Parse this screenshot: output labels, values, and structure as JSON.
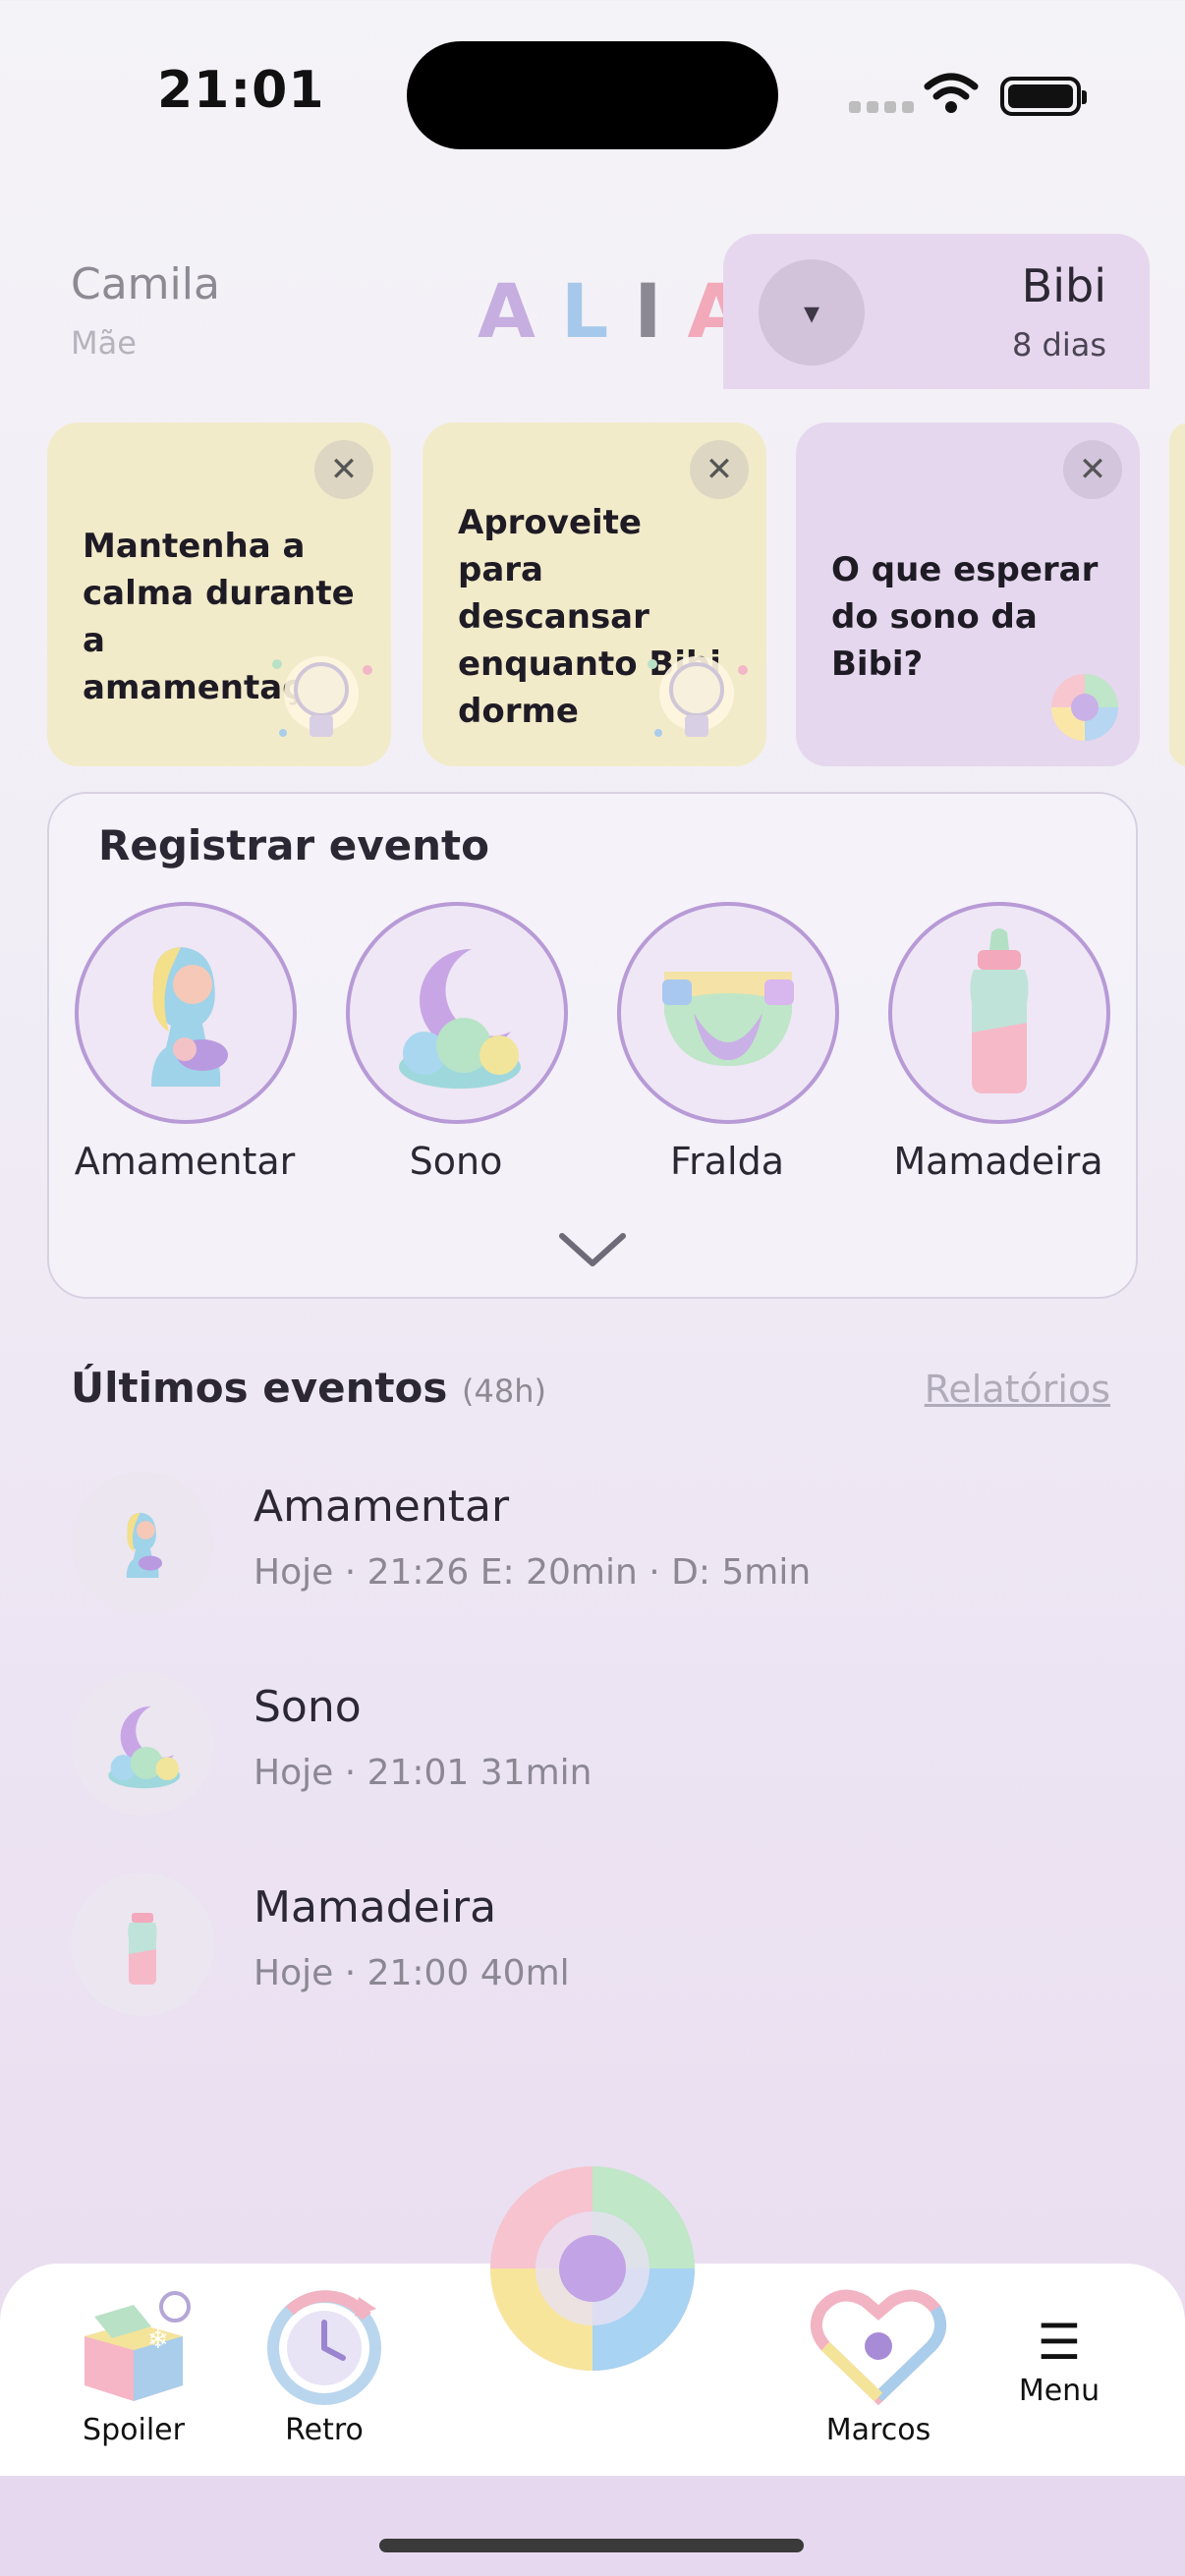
{
  "status_bar": {
    "time": "21:01"
  },
  "header": {
    "user_name": "Camila",
    "user_role": "Mãe",
    "logo": {
      "a1": "A",
      "l": "L",
      "i": "I",
      "a2": "A"
    },
    "baby_toggle": "▾",
    "baby_name": "Bibi",
    "baby_age": "8 dias"
  },
  "tips": [
    {
      "text": "Mantenha a calma durante a amamentação",
      "close": "✕",
      "icon": "lightbulb-icon"
    },
    {
      "text": "Aproveite para descansar enquanto Bibi dorme",
      "close": "✕",
      "icon": "lightbulb-icon"
    },
    {
      "text": "O que esperar do sono da Bibi?",
      "close": "✕",
      "icon": "alia-swirl-icon"
    }
  ],
  "register": {
    "title": "Registrar evento",
    "events": [
      {
        "label": "Amamentar",
        "icon": "breastfeeding-icon"
      },
      {
        "label": "Sono",
        "icon": "sleep-moon-icon"
      },
      {
        "label": "Fralda",
        "icon": "diaper-icon"
      },
      {
        "label": "Mamadeira",
        "icon": "bottle-icon"
      }
    ],
    "expand": "chevron-down-icon"
  },
  "recent": {
    "title": "Últimos eventos",
    "subtitle": "(48h)",
    "reports_link": "Relatórios",
    "items": [
      {
        "title": "Amamentar",
        "detail": "Hoje · 21:26  E: 20min · D: 5min"
      },
      {
        "title": "Sono",
        "detail": "Hoje · 21:01  31min"
      },
      {
        "title": "Mamadeira",
        "detail": "Hoje · 21:00  40ml"
      }
    ]
  },
  "nav": {
    "spoiler": "Spoiler",
    "retro": "Retro",
    "marcos": "Marcos",
    "menu": "Menu",
    "menu_icon": "☰"
  },
  "colors": {
    "accent_lilac": "#b79ad6",
    "tip_yellow": "#f2ebca",
    "tip_lilac": "#e5d7ee",
    "baby_panel": "#e6d7ee"
  }
}
